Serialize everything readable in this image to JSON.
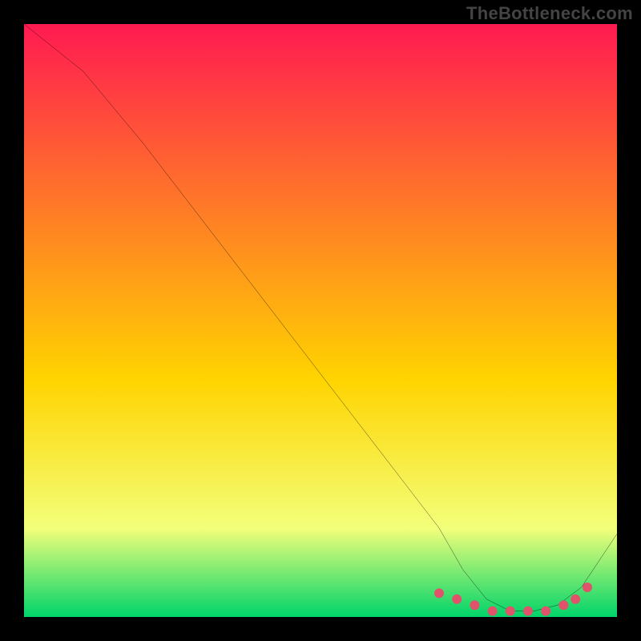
{
  "watermark": "TheBottleneck.com",
  "chart_data": {
    "type": "line",
    "title": "",
    "xlabel": "",
    "ylabel": "",
    "xlim": [
      0,
      100
    ],
    "ylim": [
      0,
      100
    ],
    "grid": false,
    "legend": false,
    "background_gradient": {
      "top_color": "#ff1a51",
      "mid_color": "#ffd400",
      "low_color": "#f3ff7a",
      "bottom_color": "#00d46a",
      "stops": [
        0,
        60,
        85,
        100
      ]
    },
    "series": [
      {
        "name": "curve",
        "color": "#000000",
        "stroke_width": 2,
        "x": [
          0,
          5,
          10,
          20,
          30,
          40,
          50,
          60,
          70,
          74,
          78,
          82,
          86,
          90,
          94,
          100
        ],
        "values": [
          100,
          96,
          92,
          80,
          67,
          54,
          41,
          28,
          15,
          8,
          3,
          1,
          1,
          2,
          5,
          14
        ]
      }
    ],
    "highlight_points": {
      "color": "#e0536a",
      "radius": 6,
      "x": [
        70,
        73,
        76,
        79,
        82,
        85,
        88,
        91,
        93,
        95
      ],
      "values": [
        4,
        3,
        2,
        1,
        1,
        1,
        1,
        2,
        3,
        5
      ]
    }
  }
}
